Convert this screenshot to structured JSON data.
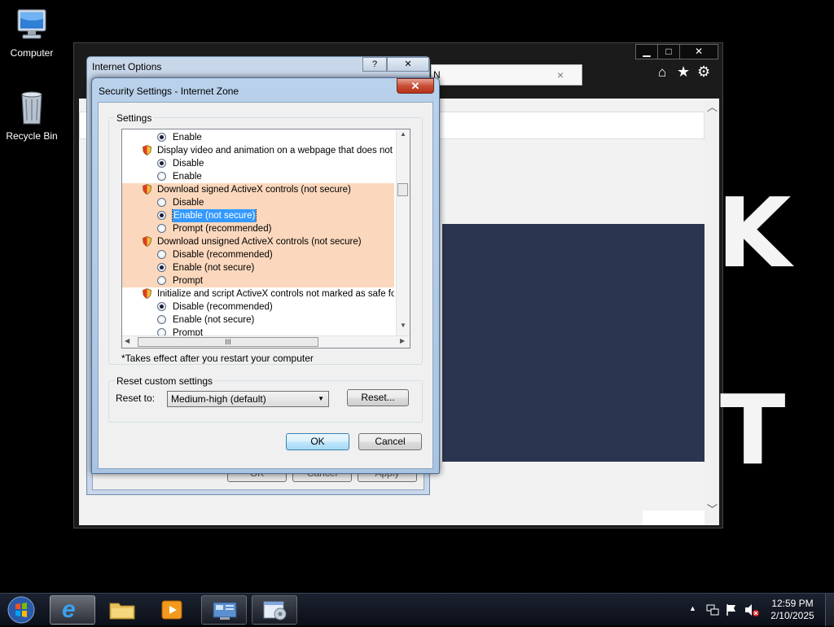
{
  "desktop": {
    "icons": [
      {
        "label": "Computer"
      },
      {
        "label": "Recycle Bin"
      }
    ]
  },
  "browser": {
    "tab_fragment": "N",
    "tab_close": "×",
    "background_letters": [
      "K",
      "T"
    ]
  },
  "internet_options": {
    "title": "Internet Options",
    "help_btn": "?",
    "close_btn": "✕",
    "buttons": {
      "ok": "OK",
      "cancel": "Cancel",
      "apply": "Apply"
    }
  },
  "security_dialog": {
    "title": "Security Settings - Internet Zone",
    "close_btn": "✕",
    "settings_group_label": "Settings",
    "settings_rows": [
      {
        "kind": "radio",
        "text": "Enable",
        "checked": true,
        "highlight": false
      },
      {
        "kind": "header",
        "text": "Display video and animation on a webpage that does not use",
        "highlight": false
      },
      {
        "kind": "radio",
        "text": "Disable",
        "checked": true,
        "highlight": false
      },
      {
        "kind": "radio",
        "text": "Enable",
        "checked": false,
        "highlight": false
      },
      {
        "kind": "header",
        "text": "Download signed ActiveX controls (not secure)",
        "highlight": true
      },
      {
        "kind": "radio",
        "text": "Disable",
        "checked": false,
        "highlight": true
      },
      {
        "kind": "radio",
        "text": "Enable (not secure)",
        "checked": true,
        "highlight": true,
        "selected": true
      },
      {
        "kind": "radio",
        "text": "Prompt (recommended)",
        "checked": false,
        "highlight": true
      },
      {
        "kind": "header",
        "text": "Download unsigned ActiveX controls (not secure)",
        "highlight": true
      },
      {
        "kind": "radio",
        "text": "Disable (recommended)",
        "checked": false,
        "highlight": true
      },
      {
        "kind": "radio",
        "text": "Enable (not secure)",
        "checked": true,
        "highlight": true
      },
      {
        "kind": "radio",
        "text": "Prompt",
        "checked": false,
        "highlight": true
      },
      {
        "kind": "header",
        "text": "Initialize and script ActiveX controls not marked as safe for sc",
        "highlight": false
      },
      {
        "kind": "radio",
        "text": "Disable (recommended)",
        "checked": true,
        "highlight": false
      },
      {
        "kind": "radio",
        "text": "Enable (not secure)",
        "checked": false,
        "highlight": false
      },
      {
        "kind": "radio",
        "text": "Prompt",
        "checked": false,
        "highlight": false
      }
    ],
    "hscroll_grip": "III",
    "restart_note": "*Takes effect after you restart your computer",
    "reset_group_label": "Reset custom settings",
    "reset_to_label": "Reset to:",
    "reset_to_value": "Medium-high (default)",
    "reset_button": "Reset...",
    "ok_button": "OK",
    "cancel_button": "Cancel"
  },
  "taskbar": {
    "time": "12:59 PM",
    "date": "2/10/2025",
    "tray_arrow": "▲"
  },
  "colors": {
    "row_highlight": "#fbd8bd",
    "selection": "#3399ff",
    "banner": "#2b3550"
  }
}
